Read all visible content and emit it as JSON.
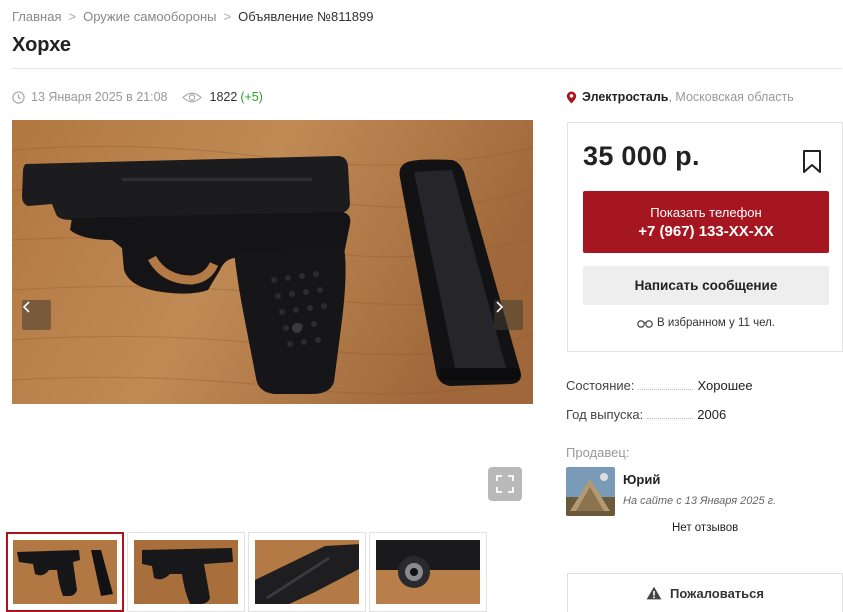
{
  "breadcrumb": {
    "items": [
      "Главная",
      "Оружие самообороны",
      "Объявление №811899"
    ],
    "separator": ">"
  },
  "title": "Хорхе",
  "meta": {
    "date": "13 Января 2025 в 21:08",
    "views": "1822",
    "views_delta": "(+5)"
  },
  "location": {
    "city": "Электросталь",
    "region": ", Московская область"
  },
  "listing": {
    "price": "35 000 р.",
    "show_phone_label": "Показать телефон",
    "phone_masked": "+7 (967) 133-XX-XX",
    "message_label": "Написать сообщение",
    "favorites_note": "В избранном у 11 чел."
  },
  "specs": [
    {
      "key": "Состояние:",
      "value": "Хорошее"
    },
    {
      "key": "Год выпуска:",
      "value": "2006"
    }
  ],
  "seller": {
    "label": "Продавец:",
    "name": "Юрий",
    "since": "На сайте с 13 Января 2025 г.",
    "reviews": "Нет отзывов"
  },
  "complain_label": "Пожаловаться",
  "gallery": {
    "prev_icon": "chevron-left-icon",
    "next_icon": "chevron-right-icon",
    "fullscreen_icon": "fullscreen-icon",
    "thumbnail_count": 4,
    "active_thumbnail": 1
  },
  "colors": {
    "accent": "#a51620",
    "positive": "#2e9c2e",
    "muted": "#999999"
  }
}
